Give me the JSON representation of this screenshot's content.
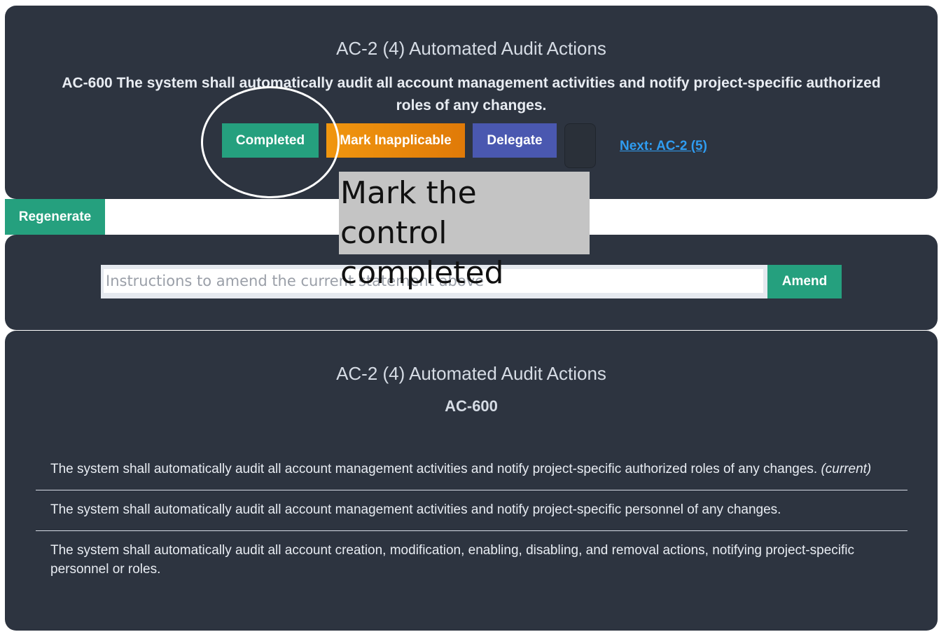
{
  "control": {
    "title": "AC-2 (4) Automated Audit Actions",
    "statement": "AC-600 The system shall automatically audit all account management activities and notify project-specific authorized roles of any changes.",
    "buttons": {
      "completed": "Completed",
      "inapplicable": "Mark Inapplicable",
      "delegate": "Delegate"
    },
    "next_link": "Next: AC-2 (5)"
  },
  "regenerate_label": "Regenerate",
  "tooltip": "Mark the control completed",
  "amend": {
    "placeholder": "Instructions to amend the current statement above",
    "value": "",
    "button_label": "Amend"
  },
  "history": {
    "title": "AC-2 (4) Automated Audit Actions",
    "id": "AC-600",
    "items": [
      {
        "text": "The system shall automatically audit all account management activities and notify project-specific authorized roles of any changes.",
        "tag": "(current)"
      },
      {
        "text": "The system shall automatically audit all account management activities and notify project-specific personnel of any changes.",
        "tag": ""
      },
      {
        "text": "The system shall automatically audit all account creation, modification, enabling, disabling, and removal actions, notifying project-specific personnel or roles.",
        "tag": ""
      }
    ]
  },
  "colors": {
    "panel": "#2d3440",
    "green": "#25a07e",
    "orange": "#f0960f",
    "indigo": "#4a58b0",
    "link": "#2f9cf0"
  }
}
